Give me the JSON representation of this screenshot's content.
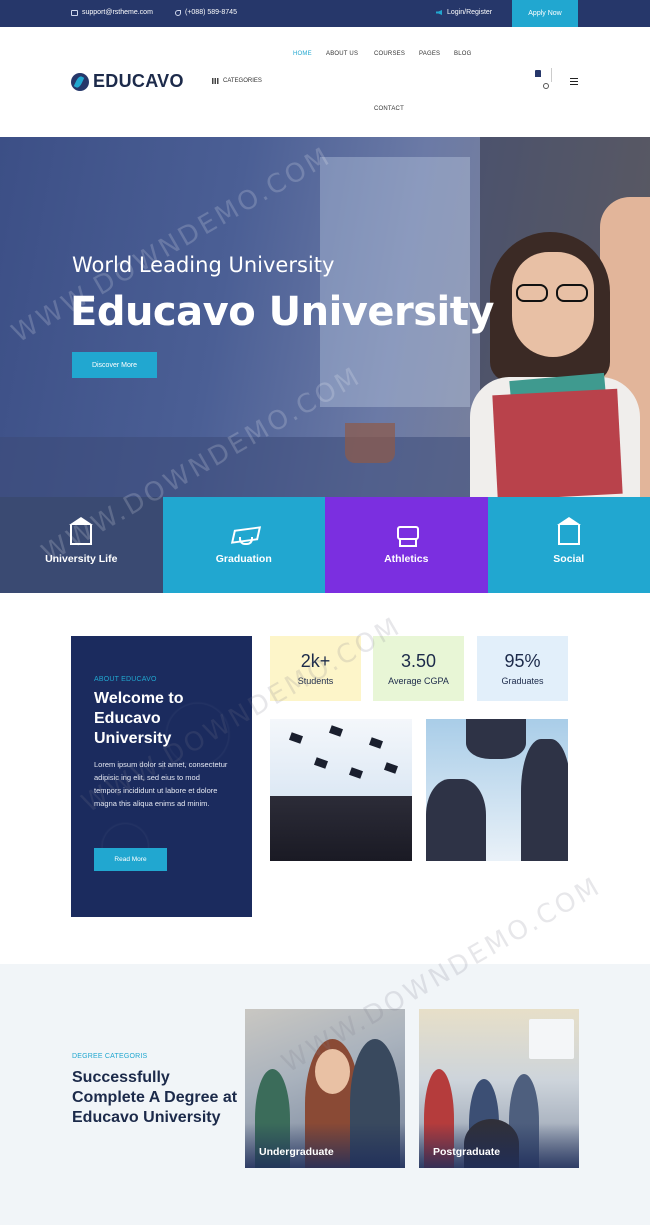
{
  "topbar": {
    "email": "support@rstheme.com",
    "phone": "(+088) 589-8745",
    "login": "Login/Register",
    "apply": "Apply Now"
  },
  "header": {
    "logo": "EDUCAVO",
    "categories": "CATEGORIES",
    "nav": {
      "home": "HOME",
      "about": "ABOUT US",
      "courses": "COURSES",
      "pages": "PAGES",
      "blog": "BLOG",
      "contact": "CONTACT"
    },
    "accent": "#21a7d0"
  },
  "hero": {
    "subtitle": "World Leading University",
    "title": "Educavo University",
    "button": "Discover More"
  },
  "tiles": [
    {
      "label": "University Life",
      "color": "#3a4a72",
      "icon": "building-icon"
    },
    {
      "label": "Graduation",
      "color": "#21a7d0",
      "icon": "graduation-cap-icon"
    },
    {
      "label": "Athletics",
      "color": "#7b2fe0",
      "icon": "trophy-icon"
    },
    {
      "label": "Social",
      "color": "#21a7d0",
      "icon": "building-icon"
    }
  ],
  "about": {
    "tag": "ABOUT EDUCAVO",
    "title": "Welcome to Educavo University",
    "text": "Lorem ipsum dolor sit amet, consectetur adipisic ing elit, sed eius to mod tempors incididunt ut labore et dolore magna this aliqua enims ad minim.",
    "button": "Read More"
  },
  "stats": [
    {
      "value": "2k+",
      "label": "Students",
      "color": "#fdf5c9"
    },
    {
      "value": "3.50",
      "label": "Average CGPA",
      "color": "#e8f6d6"
    },
    {
      "value": "95%",
      "label": "Graduates",
      "color": "#e2effa"
    }
  ],
  "degree": {
    "tag": "DEGREE CATEGORIS",
    "title": "Successfully Complete A Degree at Educavo University",
    "cards": [
      "Undergraduate",
      "Postgraduate"
    ]
  },
  "watermark": "WWW.DOWNDEMO.COM"
}
